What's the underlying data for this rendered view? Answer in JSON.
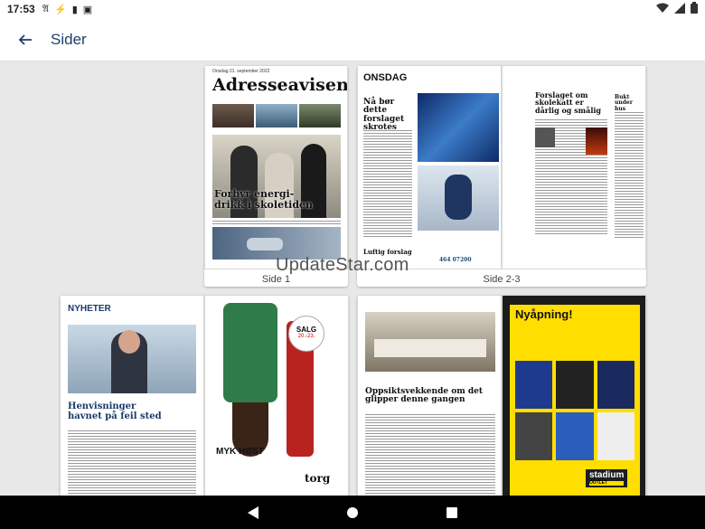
{
  "status_bar": {
    "time": "17:53",
    "icons": [
      "nyt-icon",
      "vpn-icon",
      "sim-icon",
      "notification-icon"
    ],
    "right_icons": [
      "wifi-icon",
      "signal-icon",
      "battery-icon"
    ]
  },
  "app_bar": {
    "title": "Sider"
  },
  "pages": [
    {
      "caption": "Side 1"
    },
    {
      "caption": "Side 2-3"
    }
  ],
  "page1": {
    "date_line": "Onsdag 21. september 2022",
    "masthead": "Adresseavisen",
    "headline": "Forbyr energi-\ndrikk i skoletiden"
  },
  "page23": {
    "section": "ONSDAG",
    "headline_left": "Nå bør dette forslaget skrotes",
    "headline_right": "Forslaget om skolekatt er dårlig og smålig",
    "side_headline": "Bukt under hus",
    "editorial": "Luftig forslag",
    "ad_number": "464 07200"
  },
  "page45": {
    "section": "NYHETER",
    "headline": "Henvisninger havnet på feil sted",
    "ad_sale_top": "SALG",
    "ad_sale_days": "20.-23.",
    "ad_brand": "MYK HØST",
    "ad_logo": "torg"
  },
  "page67": {
    "headline": "Oppsiktsvekkende om det glipper denne gangen",
    "ad_title": "Nyåpning!",
    "ad_brand": "stadium",
    "ad_sub": "OUTLET"
  },
  "watermark": "UpdateStar.com",
  "colors": {
    "appbar_title": "#1f3e6e",
    "background": "#e8e8e8",
    "ad_yellow": "#ffde00"
  }
}
